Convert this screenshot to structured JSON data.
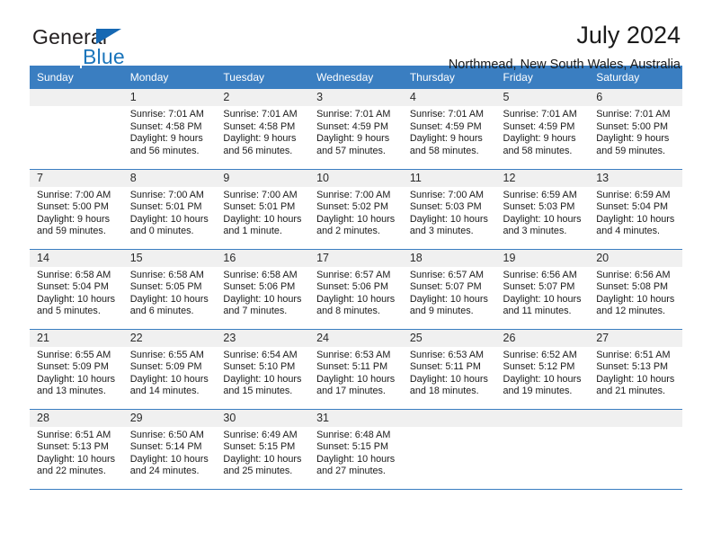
{
  "brand": {
    "name_dark": "General",
    "name_blue": "Blue",
    "accent_color": "#1b75bb",
    "triangle_color": "#1668b3"
  },
  "header": {
    "title": "July 2024",
    "subtitle": "Northmead, New South Wales, Australia",
    "header_bg_color": "#3a7ec1",
    "daynum_bg_color": "#f0f0f0"
  },
  "weekdays": [
    "Sunday",
    "Monday",
    "Tuesday",
    "Wednesday",
    "Thursday",
    "Friday",
    "Saturday"
  ],
  "labels": {
    "sunrise_prefix": "Sunrise:",
    "sunset_prefix": "Sunset:",
    "daylight_prefix": "Daylight:"
  },
  "weeks": [
    [
      {
        "day": "",
        "sunrise": "",
        "sunset": "",
        "daylight1": "",
        "daylight2": ""
      },
      {
        "day": "1",
        "sunrise": "Sunrise: 7:01 AM",
        "sunset": "Sunset: 4:58 PM",
        "daylight1": "Daylight: 9 hours",
        "daylight2": "and 56 minutes."
      },
      {
        "day": "2",
        "sunrise": "Sunrise: 7:01 AM",
        "sunset": "Sunset: 4:58 PM",
        "daylight1": "Daylight: 9 hours",
        "daylight2": "and 56 minutes."
      },
      {
        "day": "3",
        "sunrise": "Sunrise: 7:01 AM",
        "sunset": "Sunset: 4:59 PM",
        "daylight1": "Daylight: 9 hours",
        "daylight2": "and 57 minutes."
      },
      {
        "day": "4",
        "sunrise": "Sunrise: 7:01 AM",
        "sunset": "Sunset: 4:59 PM",
        "daylight1": "Daylight: 9 hours",
        "daylight2": "and 58 minutes."
      },
      {
        "day": "5",
        "sunrise": "Sunrise: 7:01 AM",
        "sunset": "Sunset: 4:59 PM",
        "daylight1": "Daylight: 9 hours",
        "daylight2": "and 58 minutes."
      },
      {
        "day": "6",
        "sunrise": "Sunrise: 7:01 AM",
        "sunset": "Sunset: 5:00 PM",
        "daylight1": "Daylight: 9 hours",
        "daylight2": "and 59 minutes."
      }
    ],
    [
      {
        "day": "7",
        "sunrise": "Sunrise: 7:00 AM",
        "sunset": "Sunset: 5:00 PM",
        "daylight1": "Daylight: 9 hours",
        "daylight2": "and 59 minutes."
      },
      {
        "day": "8",
        "sunrise": "Sunrise: 7:00 AM",
        "sunset": "Sunset: 5:01 PM",
        "daylight1": "Daylight: 10 hours",
        "daylight2": "and 0 minutes."
      },
      {
        "day": "9",
        "sunrise": "Sunrise: 7:00 AM",
        "sunset": "Sunset: 5:01 PM",
        "daylight1": "Daylight: 10 hours",
        "daylight2": "and 1 minute."
      },
      {
        "day": "10",
        "sunrise": "Sunrise: 7:00 AM",
        "sunset": "Sunset: 5:02 PM",
        "daylight1": "Daylight: 10 hours",
        "daylight2": "and 2 minutes."
      },
      {
        "day": "11",
        "sunrise": "Sunrise: 7:00 AM",
        "sunset": "Sunset: 5:03 PM",
        "daylight1": "Daylight: 10 hours",
        "daylight2": "and 3 minutes."
      },
      {
        "day": "12",
        "sunrise": "Sunrise: 6:59 AM",
        "sunset": "Sunset: 5:03 PM",
        "daylight1": "Daylight: 10 hours",
        "daylight2": "and 3 minutes."
      },
      {
        "day": "13",
        "sunrise": "Sunrise: 6:59 AM",
        "sunset": "Sunset: 5:04 PM",
        "daylight1": "Daylight: 10 hours",
        "daylight2": "and 4 minutes."
      }
    ],
    [
      {
        "day": "14",
        "sunrise": "Sunrise: 6:58 AM",
        "sunset": "Sunset: 5:04 PM",
        "daylight1": "Daylight: 10 hours",
        "daylight2": "and 5 minutes."
      },
      {
        "day": "15",
        "sunrise": "Sunrise: 6:58 AM",
        "sunset": "Sunset: 5:05 PM",
        "daylight1": "Daylight: 10 hours",
        "daylight2": "and 6 minutes."
      },
      {
        "day": "16",
        "sunrise": "Sunrise: 6:58 AM",
        "sunset": "Sunset: 5:06 PM",
        "daylight1": "Daylight: 10 hours",
        "daylight2": "and 7 minutes."
      },
      {
        "day": "17",
        "sunrise": "Sunrise: 6:57 AM",
        "sunset": "Sunset: 5:06 PM",
        "daylight1": "Daylight: 10 hours",
        "daylight2": "and 8 minutes."
      },
      {
        "day": "18",
        "sunrise": "Sunrise: 6:57 AM",
        "sunset": "Sunset: 5:07 PM",
        "daylight1": "Daylight: 10 hours",
        "daylight2": "and 9 minutes."
      },
      {
        "day": "19",
        "sunrise": "Sunrise: 6:56 AM",
        "sunset": "Sunset: 5:07 PM",
        "daylight1": "Daylight: 10 hours",
        "daylight2": "and 11 minutes."
      },
      {
        "day": "20",
        "sunrise": "Sunrise: 6:56 AM",
        "sunset": "Sunset: 5:08 PM",
        "daylight1": "Daylight: 10 hours",
        "daylight2": "and 12 minutes."
      }
    ],
    [
      {
        "day": "21",
        "sunrise": "Sunrise: 6:55 AM",
        "sunset": "Sunset: 5:09 PM",
        "daylight1": "Daylight: 10 hours",
        "daylight2": "and 13 minutes."
      },
      {
        "day": "22",
        "sunrise": "Sunrise: 6:55 AM",
        "sunset": "Sunset: 5:09 PM",
        "daylight1": "Daylight: 10 hours",
        "daylight2": "and 14 minutes."
      },
      {
        "day": "23",
        "sunrise": "Sunrise: 6:54 AM",
        "sunset": "Sunset: 5:10 PM",
        "daylight1": "Daylight: 10 hours",
        "daylight2": "and 15 minutes."
      },
      {
        "day": "24",
        "sunrise": "Sunrise: 6:53 AM",
        "sunset": "Sunset: 5:11 PM",
        "daylight1": "Daylight: 10 hours",
        "daylight2": "and 17 minutes."
      },
      {
        "day": "25",
        "sunrise": "Sunrise: 6:53 AM",
        "sunset": "Sunset: 5:11 PM",
        "daylight1": "Daylight: 10 hours",
        "daylight2": "and 18 minutes."
      },
      {
        "day": "26",
        "sunrise": "Sunrise: 6:52 AM",
        "sunset": "Sunset: 5:12 PM",
        "daylight1": "Daylight: 10 hours",
        "daylight2": "and 19 minutes."
      },
      {
        "day": "27",
        "sunrise": "Sunrise: 6:51 AM",
        "sunset": "Sunset: 5:13 PM",
        "daylight1": "Daylight: 10 hours",
        "daylight2": "and 21 minutes."
      }
    ],
    [
      {
        "day": "28",
        "sunrise": "Sunrise: 6:51 AM",
        "sunset": "Sunset: 5:13 PM",
        "daylight1": "Daylight: 10 hours",
        "daylight2": "and 22 minutes."
      },
      {
        "day": "29",
        "sunrise": "Sunrise: 6:50 AM",
        "sunset": "Sunset: 5:14 PM",
        "daylight1": "Daylight: 10 hours",
        "daylight2": "and 24 minutes."
      },
      {
        "day": "30",
        "sunrise": "Sunrise: 6:49 AM",
        "sunset": "Sunset: 5:15 PM",
        "daylight1": "Daylight: 10 hours",
        "daylight2": "and 25 minutes."
      },
      {
        "day": "31",
        "sunrise": "Sunrise: 6:48 AM",
        "sunset": "Sunset: 5:15 PM",
        "daylight1": "Daylight: 10 hours",
        "daylight2": "and 27 minutes."
      },
      {
        "day": "",
        "sunrise": "",
        "sunset": "",
        "daylight1": "",
        "daylight2": ""
      },
      {
        "day": "",
        "sunrise": "",
        "sunset": "",
        "daylight1": "",
        "daylight2": ""
      },
      {
        "day": "",
        "sunrise": "",
        "sunset": "",
        "daylight1": "",
        "daylight2": ""
      }
    ]
  ]
}
